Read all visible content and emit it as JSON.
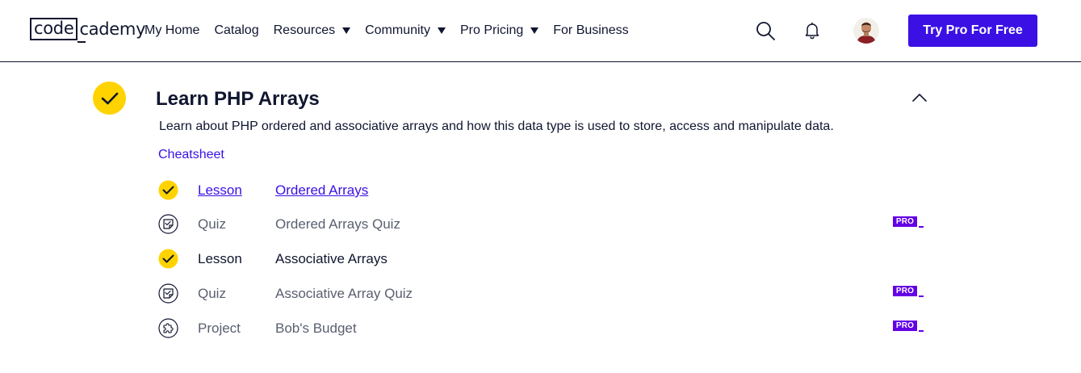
{
  "header": {
    "logo": {
      "box_text": "code",
      "rest_text": "cademy"
    },
    "nav": [
      {
        "label": "My Home",
        "dropdown": false
      },
      {
        "label": "Catalog",
        "dropdown": false
      },
      {
        "label": "Resources",
        "dropdown": true
      },
      {
        "label": "Community",
        "dropdown": true
      },
      {
        "label": "Pro Pricing",
        "dropdown": true
      },
      {
        "label": "For Business",
        "dropdown": false
      }
    ],
    "icons": {
      "search": "search-icon",
      "notifications": "bell-icon"
    },
    "cta_label": "Try Pro For Free"
  },
  "module": {
    "title": "Learn PHP Arrays",
    "description": "Learn about PHP ordered and associative arrays and how this data type is used to store, access and manipulate data.",
    "cheatsheet_label": "Cheatsheet",
    "items": [
      {
        "type": "Lesson",
        "name": "Ordered Arrays",
        "status": "completed",
        "pro": false,
        "linked": true
      },
      {
        "type": "Quiz",
        "name": "Ordered Arrays Quiz",
        "status": "quiz",
        "pro": true,
        "linked": false
      },
      {
        "type": "Lesson",
        "name": "Associative Arrays",
        "status": "completed",
        "pro": false,
        "linked": false
      },
      {
        "type": "Quiz",
        "name": "Associative Array Quiz",
        "status": "quiz",
        "pro": true,
        "linked": false
      },
      {
        "type": "Project",
        "name": "Bob's Budget",
        "status": "project",
        "pro": true,
        "linked": false
      }
    ],
    "pro_badge_label": "PRO"
  },
  "colors": {
    "brand": "#3a10e5",
    "pro": "#6400e4",
    "check_yellow": "#ffd300",
    "text_dark": "#10162f",
    "text_muted": "#5a5f70"
  }
}
